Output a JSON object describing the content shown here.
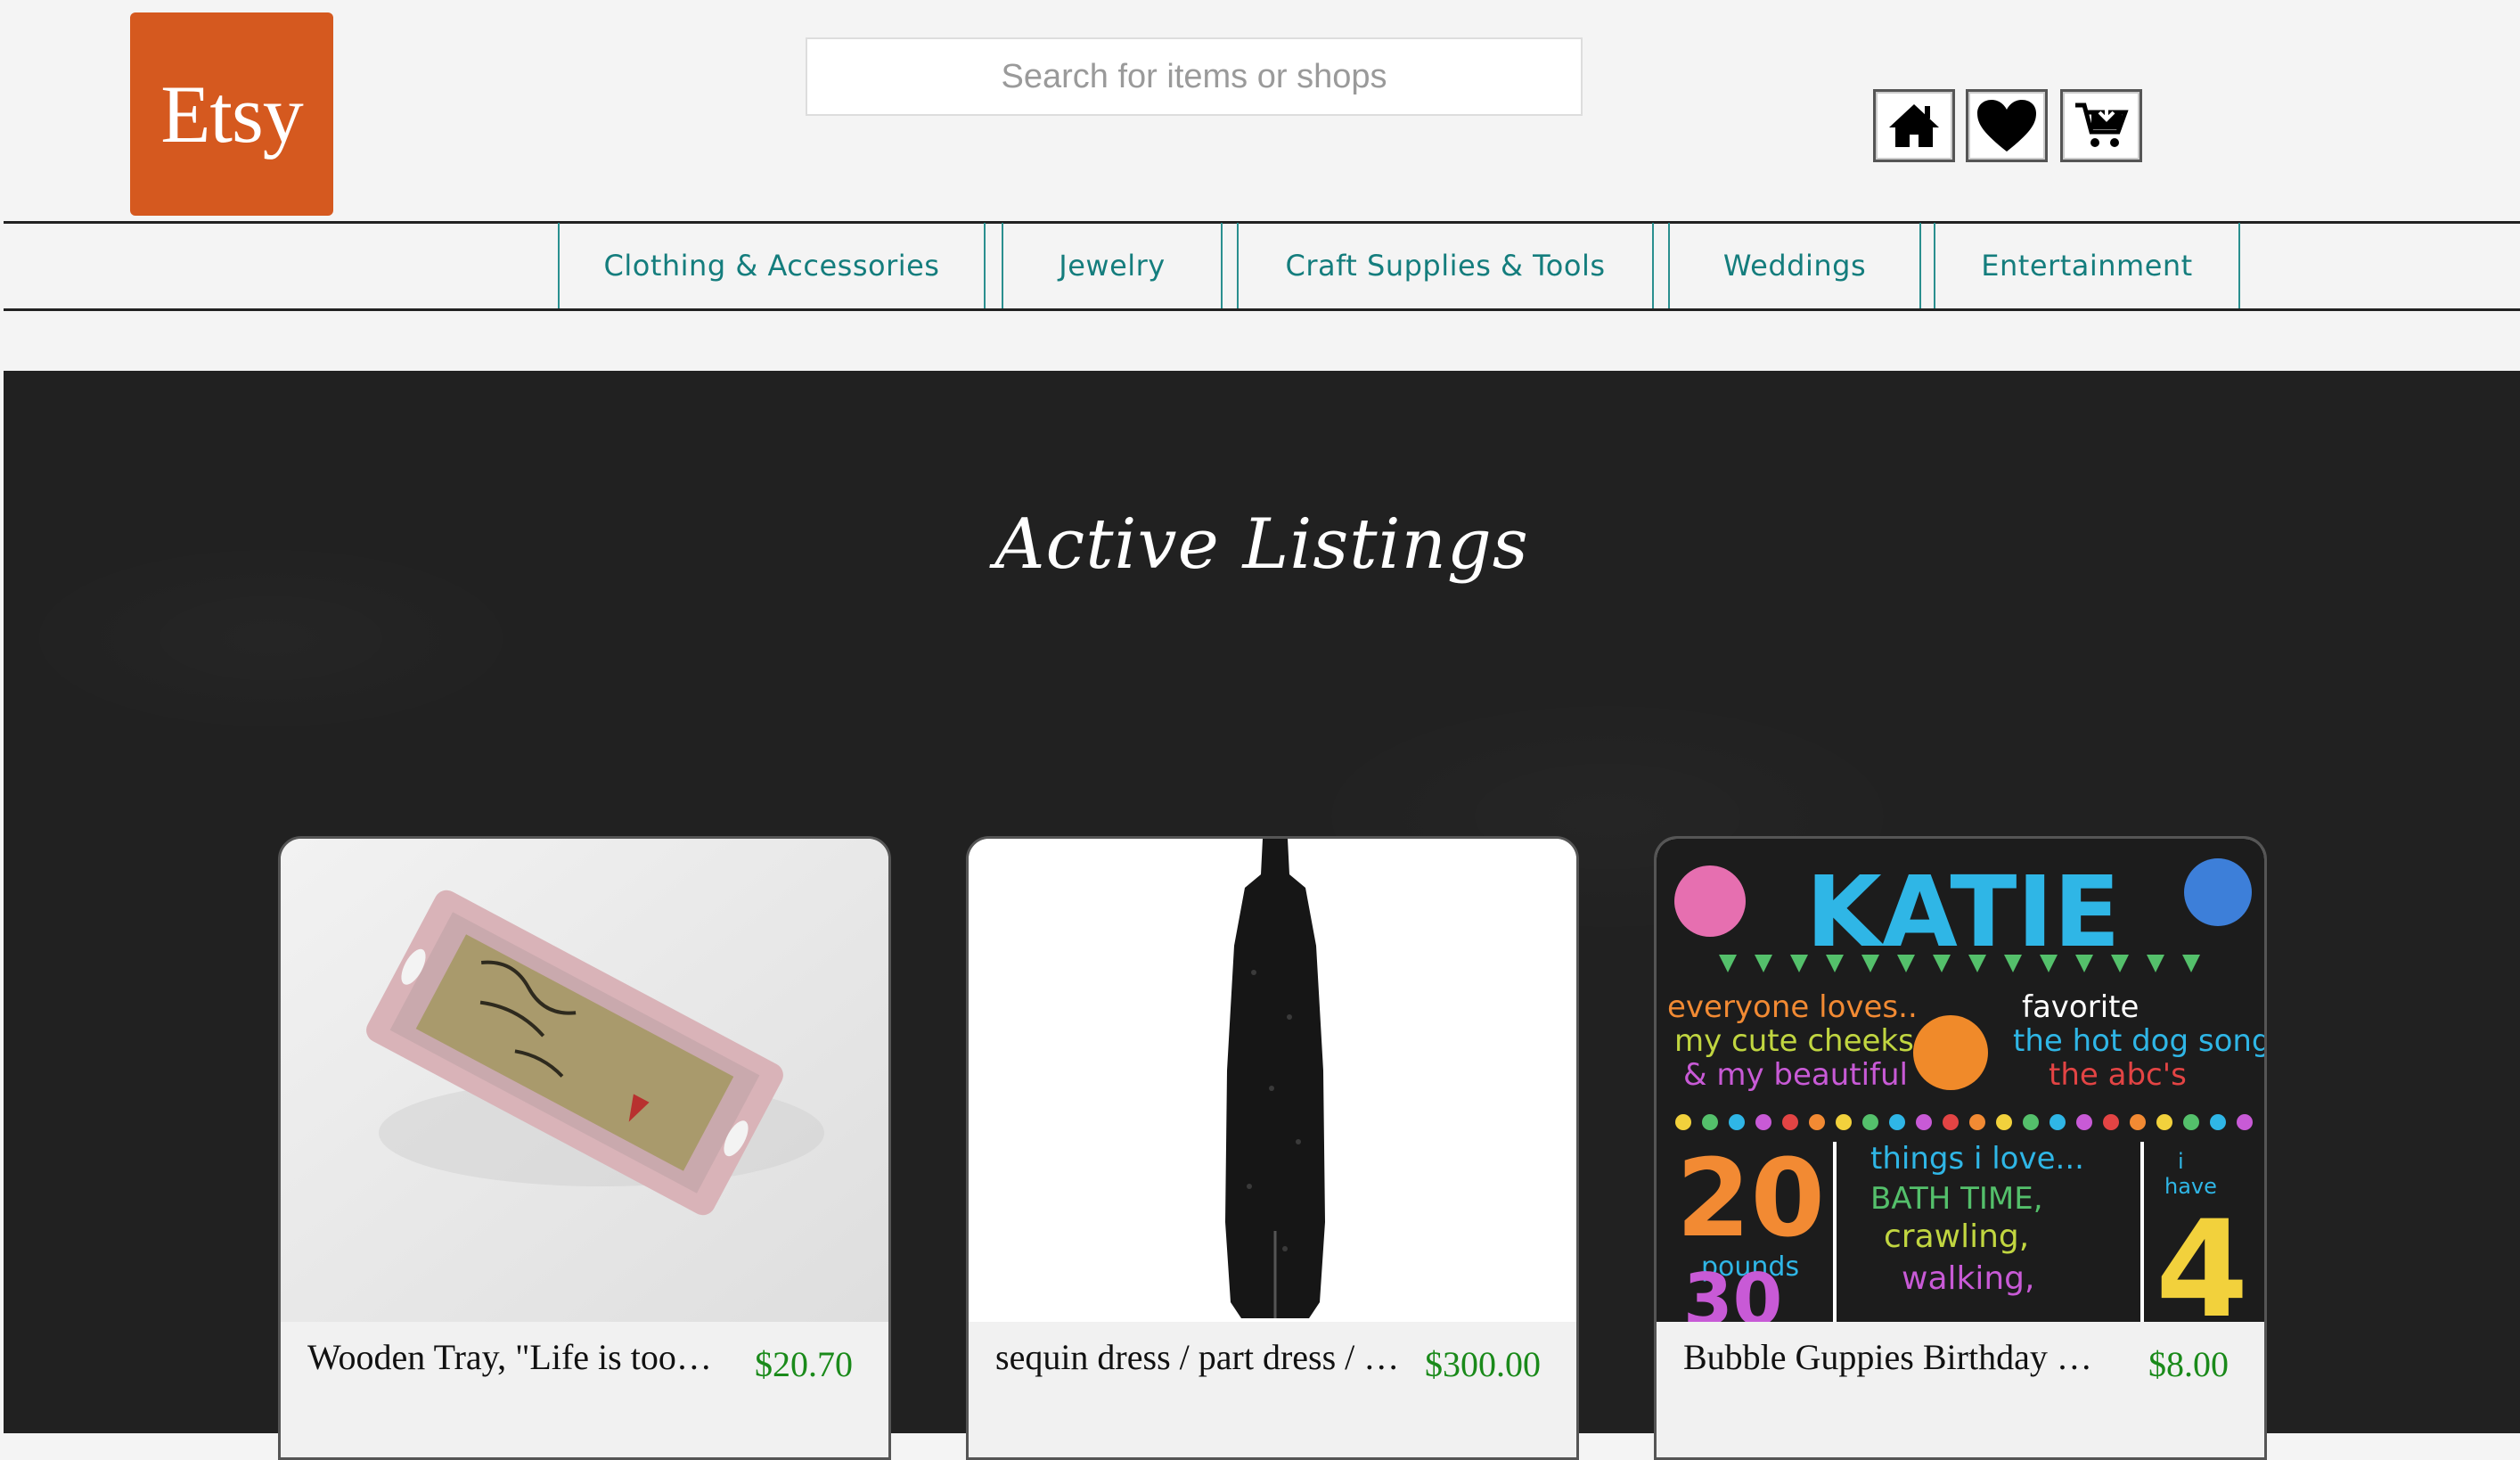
{
  "header": {
    "logo_text": "Etsy",
    "search_placeholder": "Search for items or shops",
    "icons": [
      "home-icon",
      "heart-icon",
      "cart-icon"
    ]
  },
  "nav": {
    "items": [
      {
        "label": "Clothing & Accessories"
      },
      {
        "label": "Jewelry"
      },
      {
        "label": "Craft Supplies & Tools"
      },
      {
        "label": "Weddings"
      },
      {
        "label": "Entertainment"
      }
    ]
  },
  "main": {
    "title": "Active Listings",
    "listings": [
      {
        "title": "Wooden Tray, \"Life is too short to drink bad wine\"",
        "price": "$20.70",
        "image": "wooden-tray"
      },
      {
        "title": "sequin dress / part dress / sheath",
        "price": "$300.00",
        "image": "sequin-dress"
      },
      {
        "title": "Bubble Guppies Birthday Chalkboard",
        "price": "$8.00",
        "image": "katie-chalkboard"
      }
    ]
  },
  "colors": {
    "brand": "#d5591f",
    "nav_text": "#147d7d",
    "price": "#1a8a1a",
    "main_bg": "#212121"
  }
}
